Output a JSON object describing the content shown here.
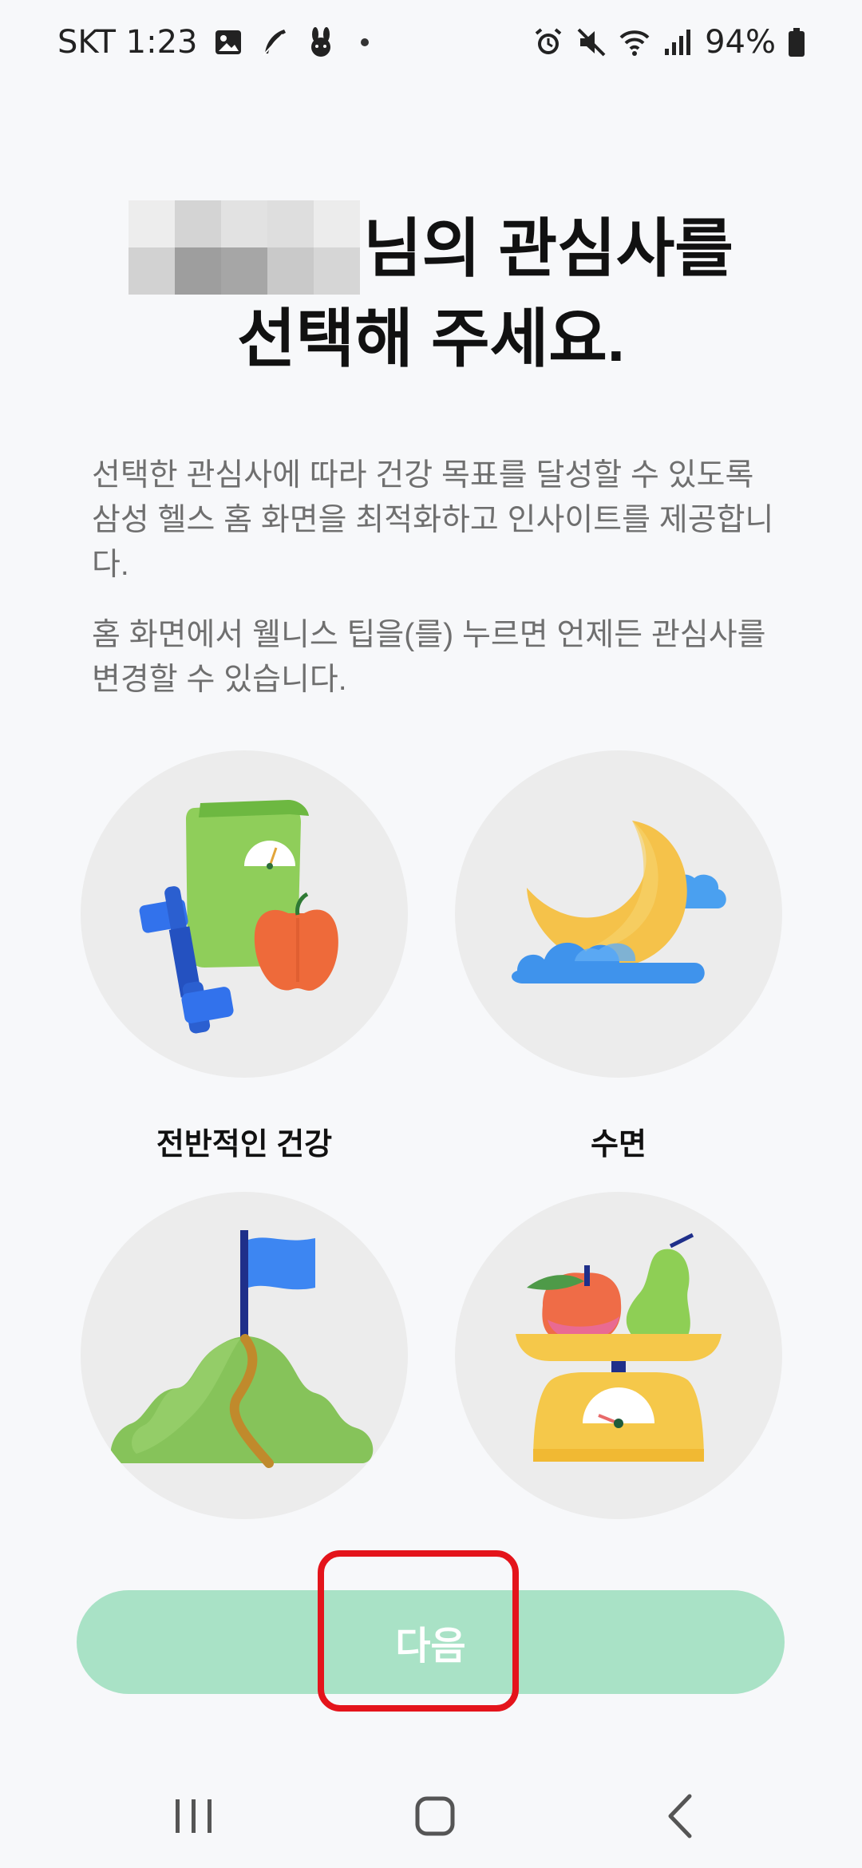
{
  "status_bar": {
    "carrier_time": "SKT 1:23",
    "battery": "94%",
    "icons_left": [
      "gallery-icon",
      "feather-icon",
      "rabbit-icon",
      "dot"
    ],
    "icons_right": [
      "alarm-icon",
      "mute-icon",
      "wifi-icon",
      "signal-icon",
      "battery-icon"
    ]
  },
  "heading": {
    "line1_suffix": "님의 관심사를",
    "line2": "선택해 주세요."
  },
  "description": {
    "paragraph1": "선택한 관심사에 따라 건강 목표를 달성할 수 있도록 삼성 헬스 홈 화면을 최적화하고 인사이트를 제공합니다.",
    "paragraph2": "홈 화면에서 웰니스 팁을(를) 누르면 언제든 관심사를 변경할 수 있습니다."
  },
  "interests": [
    {
      "label": "전반적인 건강",
      "icon": "overall-health-icon"
    },
    {
      "label": "수면",
      "icon": "sleep-moon-icon"
    },
    {
      "label": "",
      "icon": "mountain-flag-icon"
    },
    {
      "label": "",
      "icon": "fruit-scale-icon"
    }
  ],
  "next_button": {
    "label": "다음"
  },
  "colors": {
    "background": "#f7f8fa",
    "button": "#a9e2c6",
    "highlight": "#e4141b",
    "circle": "#ececec"
  }
}
